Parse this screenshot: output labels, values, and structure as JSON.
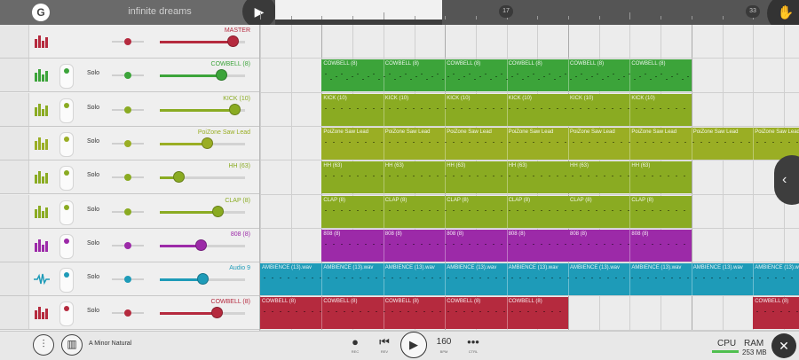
{
  "song_title": "infinite dreams",
  "ruler": {
    "markers": [
      "17",
      "33"
    ]
  },
  "tracks": [
    {
      "name": "MASTER",
      "color": "#b52a3e",
      "icon": "master-bars-icon",
      "solo": "",
      "volume": 0.85,
      "pan": 0.5,
      "clips": []
    },
    {
      "name": "COWBELL (8)",
      "color": "#3ca43a",
      "icon": "drum-bars-icon",
      "solo": "Solo",
      "volume": 0.72,
      "pan": 0.5,
      "clips": [
        {
          "label": "COWBELL (8)",
          "start": 2,
          "end": 14
        }
      ]
    },
    {
      "name": "KICK (10)",
      "color": "#8aab22",
      "icon": "drum-bars-icon",
      "solo": "Solo",
      "volume": 0.88,
      "pan": 0.5,
      "clips": [
        {
          "label": "KICK (10)",
          "start": 2,
          "end": 10
        },
        {
          "label": "KICK (10)",
          "start": 10,
          "end": 14
        }
      ]
    },
    {
      "name": "PoiZone Saw Lead",
      "color": "#9aae24",
      "icon": "synth-bars-icon",
      "solo": "Solo",
      "volume": 0.55,
      "pan": 0.5,
      "clips": [
        {
          "label": "PoiZone Saw Lead",
          "start": 2,
          "end": 18
        }
      ]
    },
    {
      "name": "HH (63)",
      "color": "#8aab22",
      "icon": "drum-bars-icon",
      "solo": "Solo",
      "volume": 0.22,
      "pan": 0.5,
      "clips": [
        {
          "label": "HH (63)",
          "start": 2,
          "end": 10
        },
        {
          "label": "HH (63)",
          "start": 10,
          "end": 14
        }
      ]
    },
    {
      "name": "CLAP (8)",
      "color": "#8aab22",
      "icon": "drum-bars-icon",
      "solo": "Solo",
      "volume": 0.68,
      "pan": 0.5,
      "clips": [
        {
          "label": "CLAP (8)",
          "start": 2,
          "end": 10
        },
        {
          "label": "CLAP (8)",
          "start": 10,
          "end": 14
        }
      ]
    },
    {
      "name": "808 (8)",
      "color": "#9c2aa8",
      "icon": "drum-bars-icon",
      "solo": "Solo",
      "volume": 0.48,
      "pan": 0.5,
      "clips": [
        {
          "label": "808 (8)",
          "start": 2,
          "end": 10
        },
        {
          "label": "808 (8)",
          "start": 10,
          "end": 14
        }
      ]
    },
    {
      "name": "Audio 9",
      "color": "#1e9bb8",
      "icon": "waveform-icon",
      "solo": "Solo",
      "volume": 0.5,
      "pan": 0.5,
      "clips": [
        {
          "label": "AMBIENCE (13).wav",
          "start": 0,
          "end": 18
        }
      ]
    },
    {
      "name": "COWBELL (8)",
      "color": "#b52a3e",
      "icon": "drum-bars-icon",
      "solo": "Solo",
      "volume": 0.67,
      "pan": 0.5,
      "clips": [
        {
          "label": "COWBELL (8)",
          "start": 0,
          "end": 10
        },
        {
          "label": "COWBELL (8)",
          "start": 16,
          "end": 18
        }
      ]
    }
  ],
  "bottom": {
    "scale": "A Minor Natural",
    "rec_label": "REC",
    "rev_label": "REV",
    "bpm_value": "160",
    "bpm_label": "BPM",
    "ctrl_label": "CTRL",
    "cpu_label": "CPU",
    "ram_label": "RAM",
    "ram_value": "253 MB"
  }
}
